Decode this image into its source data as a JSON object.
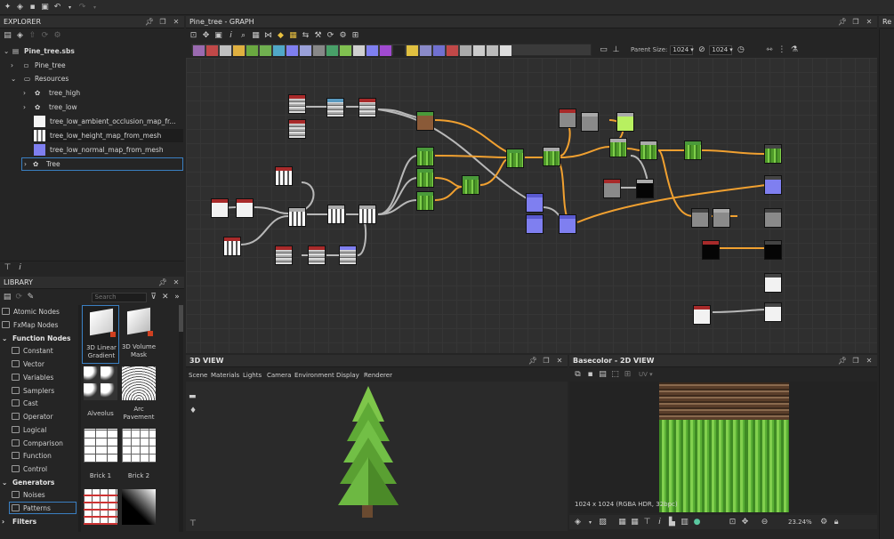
{
  "top_toolbar": {
    "icons": [
      "new-icon",
      "open-icon",
      "save-icon",
      "save-all-icon",
      "undo-icon",
      "redo-icon"
    ]
  },
  "explorer": {
    "title": "EXPLORER",
    "items": [
      {
        "label": "Pine_tree.sbs"
      },
      {
        "label": "Pine_tree"
      },
      {
        "label": "Resources"
      },
      {
        "label": "tree_high"
      },
      {
        "label": "tree_low"
      },
      {
        "label": "tree_low_ambient_occlusion_map_fr..."
      },
      {
        "label": "tree_low_height_map_from_mesh"
      },
      {
        "label": "tree_low_normal_map_from_mesh"
      },
      {
        "label": "Tree"
      }
    ]
  },
  "library": {
    "title": "LIBRARY",
    "search_placeholder": "Search",
    "categories": [
      {
        "label": "Atomic Nodes"
      },
      {
        "label": "FxMap Nodes"
      },
      {
        "label": "Function Nodes"
      },
      {
        "label": "Constant"
      },
      {
        "label": "Vector"
      },
      {
        "label": "Variables"
      },
      {
        "label": "Samplers"
      },
      {
        "label": "Cast"
      },
      {
        "label": "Operator"
      },
      {
        "label": "Logical"
      },
      {
        "label": "Comparison"
      },
      {
        "label": "Function"
      },
      {
        "label": "Control"
      },
      {
        "label": "Generators"
      },
      {
        "label": "Noises"
      },
      {
        "label": "Patterns"
      },
      {
        "label": "Filters"
      }
    ],
    "thumbnails": [
      {
        "label": "3D Linear Gradient"
      },
      {
        "label": "3D Volume Mask"
      },
      {
        "label": "Alveolus"
      },
      {
        "label": "Arc Pavement"
      },
      {
        "label": "Brick 1"
      },
      {
        "label": "Brick 2"
      }
    ]
  },
  "graph": {
    "title": "Pine_tree - GRAPH",
    "parent_size_label": "Parent Size:",
    "parent_size_value": "1024",
    "size_value": "1024"
  },
  "view3d": {
    "title": "3D VIEW",
    "menu": [
      "Scene",
      "Materials",
      "Lights",
      "Camera",
      "Environment",
      "Display",
      "Renderer"
    ]
  },
  "view2d": {
    "title": "Basecolor - 2D VIEW",
    "uv_label": "UV",
    "info": "1024 x 1024 (RGBA HDR, 32bpc)",
    "zoom": "23.24%"
  },
  "right_panel": {
    "title": "Re"
  },
  "colors": {
    "accent": "#3a7fc1",
    "connection": "#f0a030",
    "background": "#252525"
  }
}
